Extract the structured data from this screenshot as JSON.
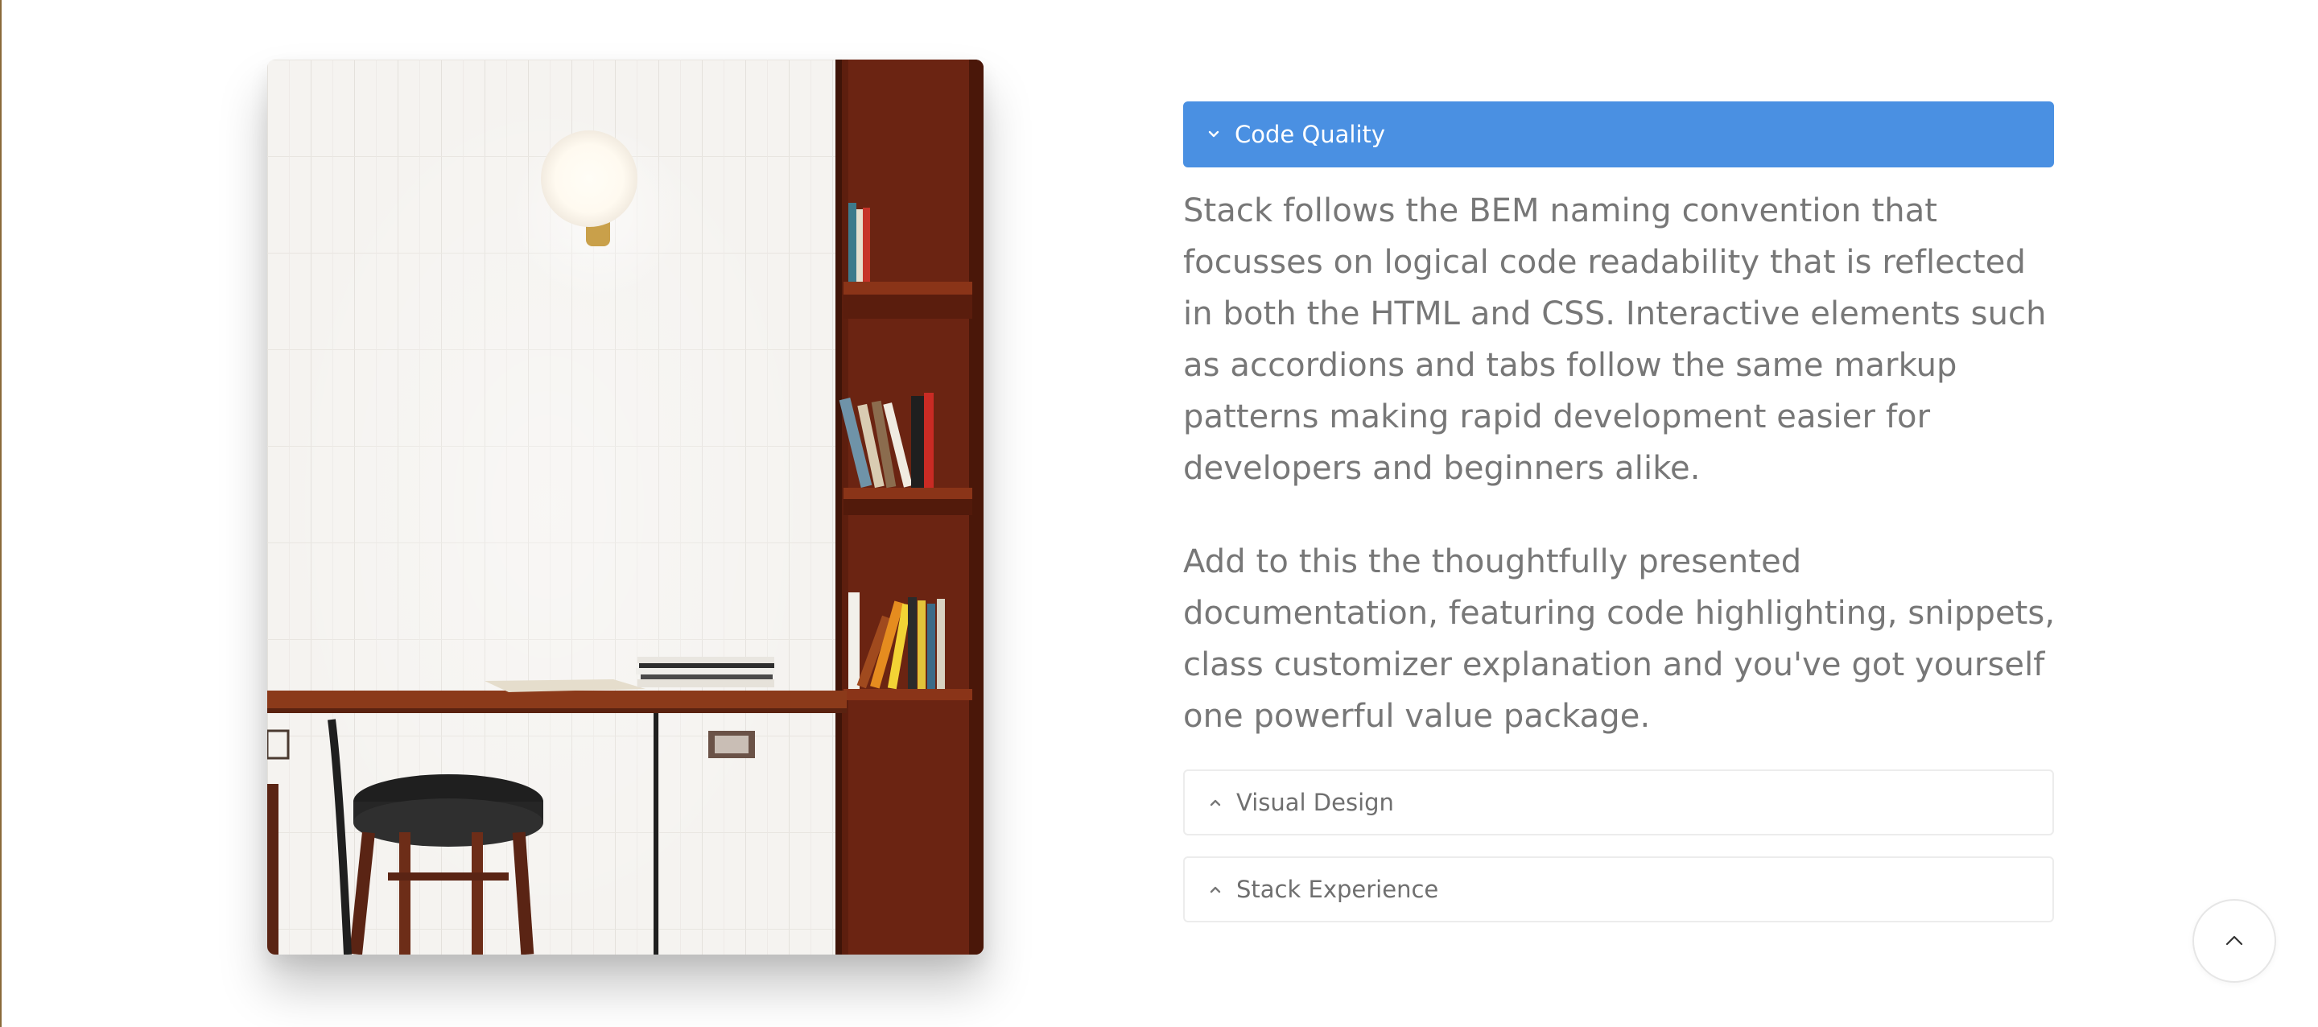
{
  "accordion": {
    "items": [
      {
        "title": "Code Quality",
        "expanded": true,
        "paragraphs": [
          "Stack follows the BEM naming convention that focusses on logical code readability that is reflected in both the HTML and CSS. Interactive elements such as accordions and tabs follow the same markup patterns making rapid development easier for developers and beginners alike.",
          "Add to this the thoughtfully presented documentation, featuring code highlighting, snippets, class customizer explanation and you've got yourself one powerful value package."
        ]
      },
      {
        "title": "Visual Design",
        "expanded": false
      },
      {
        "title": "Stack Experience",
        "expanded": false
      }
    ]
  },
  "icons": {
    "expanded_chevron": "chevron-down-icon",
    "collapsed_chevron": "chevron-up-icon",
    "back_to_top": "arrow-up-icon"
  },
  "colors": {
    "accent": "#4a90e2",
    "body_text": "#777777",
    "inactive_border": "#ececec"
  }
}
